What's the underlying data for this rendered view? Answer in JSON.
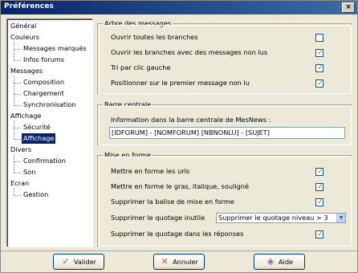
{
  "window": {
    "title": "Préférences",
    "close_glyph": "×"
  },
  "tree": {
    "items": [
      {
        "label": "Général",
        "level": 0,
        "selected": false
      },
      {
        "label": "Couleurs",
        "level": 0,
        "selected": false
      },
      {
        "label": "Messages marqués",
        "level": 1,
        "selected": false
      },
      {
        "label": "Infos forums",
        "level": 1,
        "selected": false
      },
      {
        "label": "Messages",
        "level": 0,
        "selected": false
      },
      {
        "label": "Composition",
        "level": 1,
        "selected": false
      },
      {
        "label": "Chargement",
        "level": 1,
        "selected": false
      },
      {
        "label": "Synchronisation",
        "level": 1,
        "selected": false
      },
      {
        "label": "Affichage",
        "level": 0,
        "selected": false
      },
      {
        "label": "Sécurité",
        "level": 1,
        "selected": false
      },
      {
        "label": "Affichage",
        "level": 1,
        "selected": true
      },
      {
        "label": "Divers",
        "level": 0,
        "selected": false
      },
      {
        "label": "Confirmation",
        "level": 1,
        "selected": false
      },
      {
        "label": "Son",
        "level": 1,
        "selected": false
      },
      {
        "label": "Ecran",
        "level": 0,
        "selected": false
      },
      {
        "label": "Gestion",
        "level": 1,
        "selected": false
      }
    ]
  },
  "arbre": {
    "title": "Arbre des messages",
    "options": [
      {
        "label": "Ouvrir toutes les branches",
        "checked": false
      },
      {
        "label": "Ouvrir les branches avec des messages non lus",
        "checked": true
      },
      {
        "label": "Tri par clic gauche",
        "checked": true
      },
      {
        "label": "Positionner sur le premier message non lu",
        "checked": true
      }
    ]
  },
  "barre": {
    "title": "Barre centrale",
    "info_label": "Information dans la barre centrale de MesNews :",
    "info_value": "[IDFORUM] - [NOMFORUM] [NBNONLU] - [SUJET]"
  },
  "mise": {
    "title": "Mise en forme",
    "options": [
      {
        "label": "Mettre en forme les urls",
        "checked": true
      },
      {
        "label": "Mettre en forme le gras, italique, souligné",
        "checked": true
      },
      {
        "label": "Supprimer la balise de mise en forme",
        "checked": true
      }
    ],
    "quotage_label": "Supprimer le quotage inutile",
    "quotage_select": "Supprimer le quotage niveau > 3",
    "reponses_label": "Supprimer le quotage dans les réponses",
    "reponses_checked": true
  },
  "buttons": {
    "valider": "Valider",
    "annuler": "Annuler",
    "aide": "Aide"
  },
  "colors": {
    "check": "#21a121",
    "selection": "#0a246a",
    "cancel_icon": "#e05a1a"
  }
}
